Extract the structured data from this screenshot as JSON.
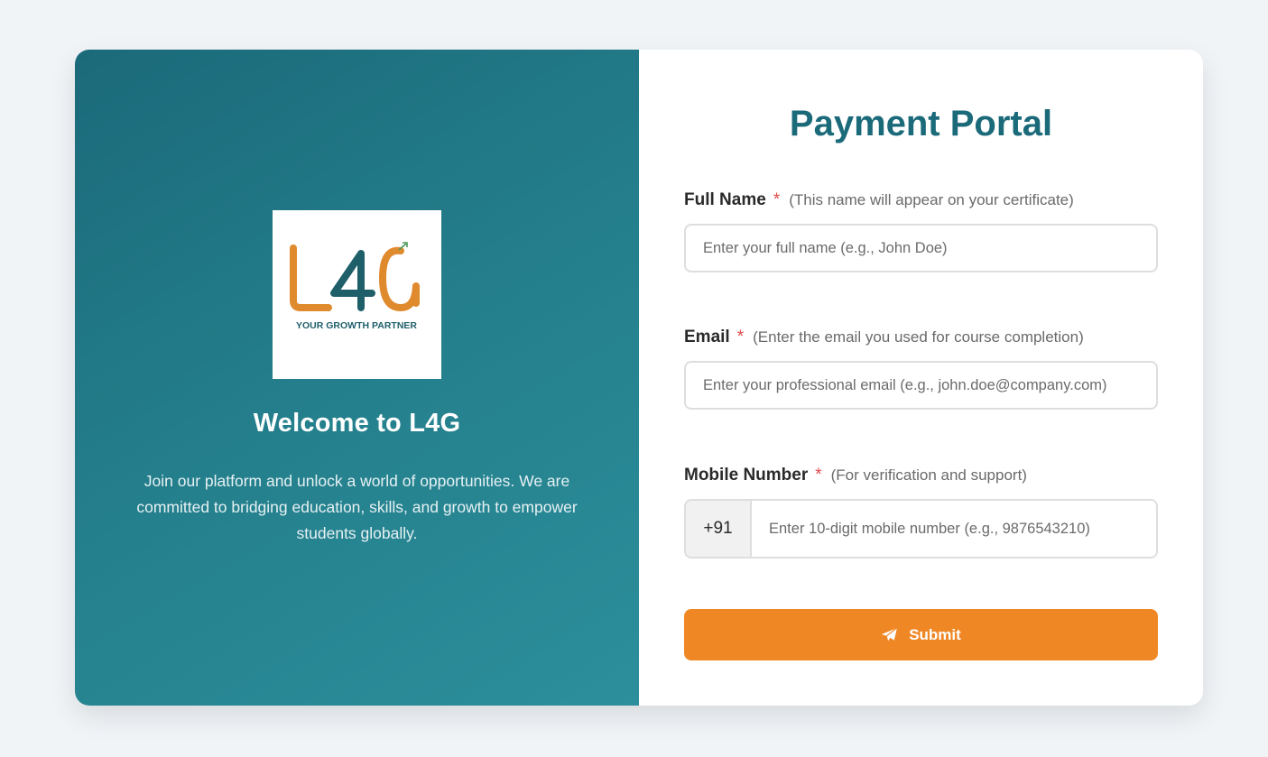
{
  "left_panel": {
    "logo": {
      "wordmark": "L4G",
      "tagline": "YOUR GROWTH PARTNER",
      "colors": {
        "orange": "#e08a2e",
        "teal": "#1f5f6a"
      }
    },
    "welcome_title": "Welcome to L4G",
    "description": "Join our platform and unlock a world of opportunities. We are committed to bridging education, skills, and growth to empower students globally."
  },
  "form": {
    "title": "Payment Portal",
    "full_name": {
      "label": "Full Name",
      "required_mark": "*",
      "hint": "(This name will appear on your certificate)",
      "placeholder": "Enter your full name (e.g., John Doe)",
      "value": ""
    },
    "email": {
      "label": "Email",
      "required_mark": "*",
      "hint": "(Enter the email you used for course completion)",
      "placeholder": "Enter your professional email (e.g., john.doe@company.com)",
      "value": ""
    },
    "mobile": {
      "label": "Mobile Number",
      "required_mark": "*",
      "hint": "(For verification and support)",
      "country_code": "+91",
      "placeholder": "Enter 10-digit mobile number (e.g., 9876543210)",
      "value": ""
    },
    "submit": {
      "label": "Submit",
      "icon": "paper-plane-icon"
    }
  },
  "colors": {
    "page_bg": "#f0f4f7",
    "panel_gradient_start": "#1b6a7a",
    "panel_gradient_end": "#2c8f9b",
    "title": "#1b6a7a",
    "required": "#e04a4a",
    "button": "#ef8725"
  }
}
